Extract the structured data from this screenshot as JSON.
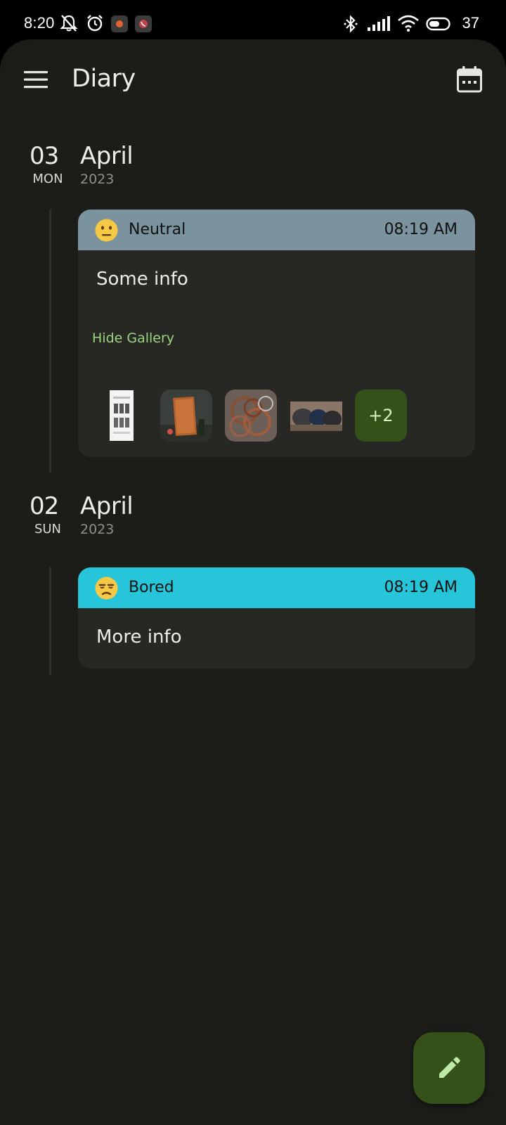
{
  "status_bar": {
    "time": "8:20",
    "battery_level": "37",
    "icons": [
      "muted-bell-icon",
      "alarm-icon",
      "app-notification-icon",
      "phone-app-icon",
      "bluetooth-icon",
      "signal-icon",
      "wifi-icon",
      "battery-icon"
    ]
  },
  "header": {
    "title": "Diary",
    "menu_icon": "hamburger-menu-icon",
    "calendar_icon": "calendar-icon"
  },
  "entries": [
    {
      "day": "03",
      "weekday": "MON",
      "month": "April",
      "year": "2023",
      "mood": "Neutral",
      "mood_color": "#7a939f",
      "mood_icon": "neutral-face-icon",
      "time": "08:19 AM",
      "text": "Some info",
      "gallery_toggle": "Hide Gallery",
      "more_images": "+2"
    },
    {
      "day": "02",
      "weekday": "SUN",
      "month": "April",
      "year": "2023",
      "mood": "Bored",
      "mood_color": "#26c5da",
      "mood_icon": "unamused-face-icon",
      "time": "08:19 AM",
      "text": "More info"
    }
  ],
  "fab": {
    "icon": "pencil-edit-icon"
  },
  "colors": {
    "background": "#1c1c19",
    "card": "#272724",
    "accent_green": "#34511a",
    "link_green": "#9bd67f"
  }
}
